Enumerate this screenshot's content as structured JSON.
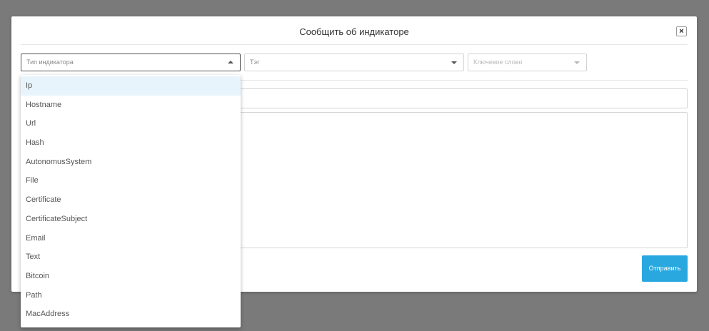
{
  "modal": {
    "title": "Сообщить об индикаторе",
    "close_label": "×"
  },
  "filters": {
    "indicator_type": {
      "placeholder": "Тип индикатора",
      "state": "open"
    },
    "tag": {
      "placeholder": "Тэг"
    },
    "keyword": {
      "placeholder": "Ключевое слово",
      "state": "disabled"
    }
  },
  "dropdown": {
    "options": [
      "Ip",
      "Hostname",
      "Url",
      "Hash",
      "AutonomusSystem",
      "File",
      "Certificate",
      "CertificateSubject",
      "Email",
      "Text",
      "Bitcoin",
      "Path",
      "MacAddress"
    ],
    "highlighted_index": 0
  },
  "form": {
    "submit_label": "Отправить"
  },
  "colors": {
    "overlay": "#7a7a7a",
    "accent": "#29a8e0",
    "highlight": "#e8f4fb"
  }
}
